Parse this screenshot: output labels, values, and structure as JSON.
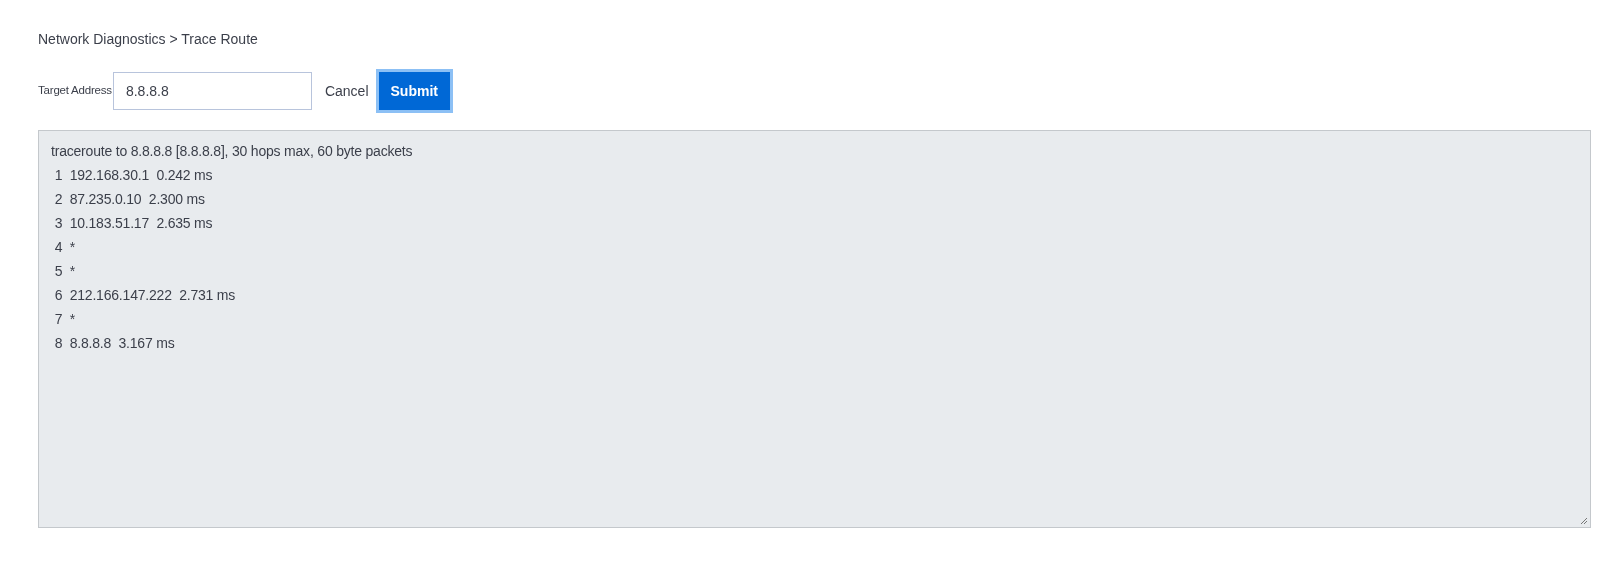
{
  "breadcrumb": "Network Diagnostics > Trace Route",
  "form": {
    "label": "Target Address",
    "value": "8.8.8.8",
    "cancel": "Cancel",
    "submit": "Submit",
    "submit_focused": true
  },
  "output": {
    "lines": [
      "traceroute to 8.8.8.8 [8.8.8.8], 30 hops max, 60 byte packets",
      " 1  192.168.30.1  0.242 ms",
      " 2  87.235.0.10  2.300 ms",
      " 3  10.183.51.17  2.635 ms",
      " 4  *",
      " 5  *",
      " 6  212.166.147.222  2.731 ms",
      " 7  *",
      " 8  8.8.8.8  3.167 ms"
    ]
  }
}
